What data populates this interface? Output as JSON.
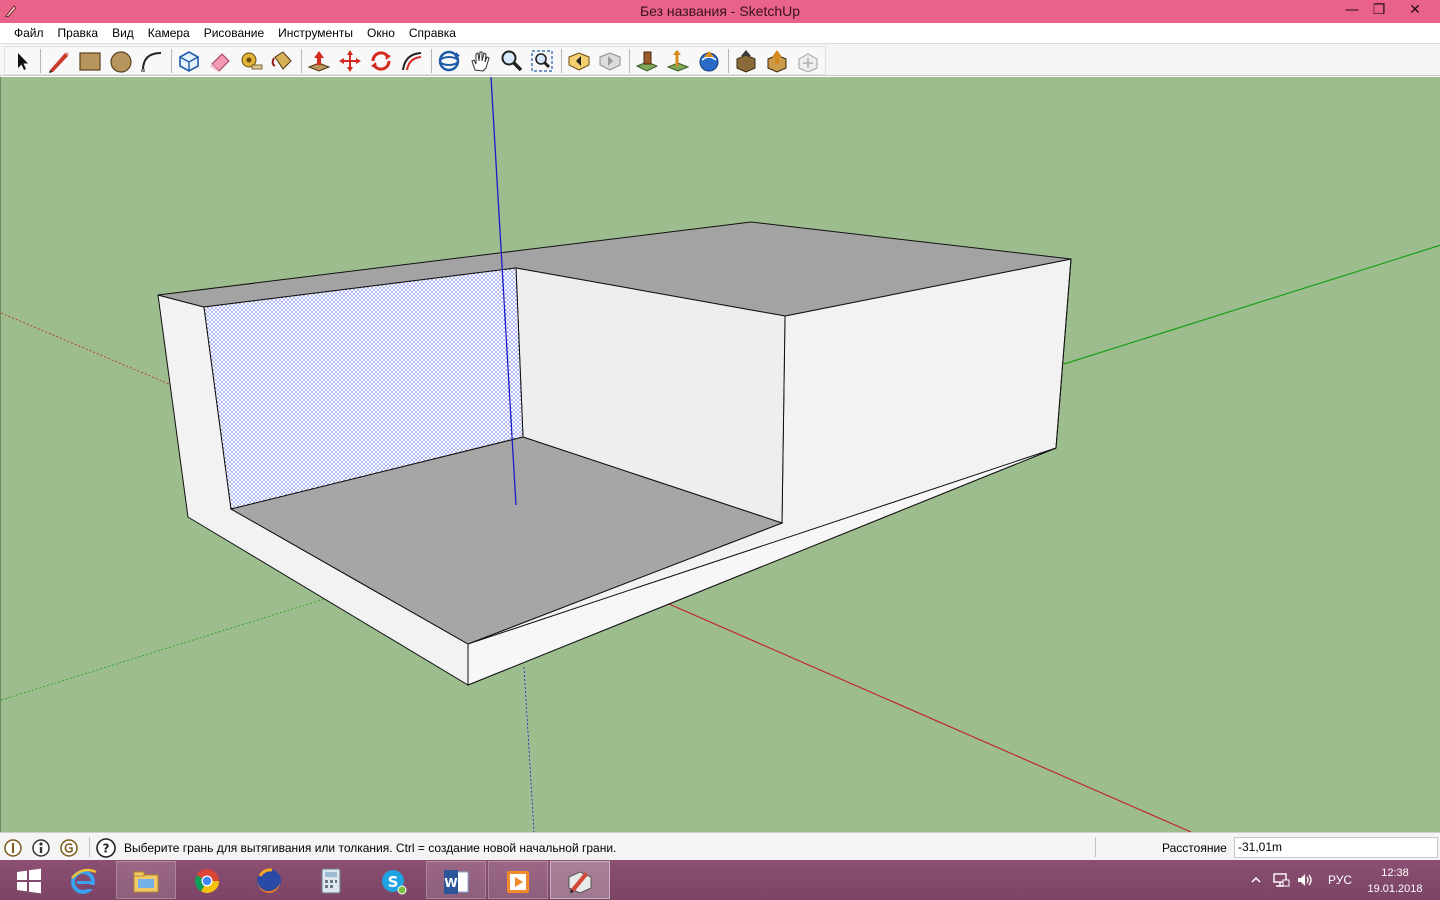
{
  "window": {
    "title": "Без названия - SketchUp",
    "min_glyph": "—",
    "max_glyph": "❐",
    "close_glyph": "✕"
  },
  "menu": [
    "Файл",
    "Правка",
    "Вид",
    "Камера",
    "Рисование",
    "Инструменты",
    "Окно",
    "Справка"
  ],
  "toolbar": {
    "tools": [
      "select-tool-icon",
      "pencil-line-tool-icon",
      "rectangle-tool-icon",
      "circle-tool-icon",
      "arc-tool-icon",
      "make-component-icon",
      "eraser-tool-icon",
      "tape-measure-tool-icon",
      "paint-bucket-tool-icon",
      "push-pull-tool-icon",
      "move-tool-icon",
      "rotate-tool-icon",
      "follow-me-tool-icon",
      "orbit-tool-icon",
      "pan-tool-icon",
      "zoom-tool-icon",
      "zoom-extents-icon",
      "previous-view-icon",
      "next-view-icon",
      "add-location-icon",
      "toggle-terrain-icon",
      "get-models-icon",
      "share-model-icon",
      "upload-component-icon",
      "extension-warehouse-icon"
    ]
  },
  "colors": {
    "titlebar": "#e8628a",
    "viewport_background": "#9dbd8e",
    "axis_red": "#c0272d",
    "axis_green": "#1aa11a",
    "axis_blue": "#1c1cc8",
    "selection_fill": "#aab2f0"
  },
  "status": {
    "icons": [
      "geo-location-icon",
      "credits-icon",
      "user-account-icon"
    ],
    "help_icon": "help-icon",
    "hint": "Выберите грань для вытягивания или толкания.  Ctrl = создание новой начальной грани.",
    "measurement_label": "Расстояние",
    "measurement_value": "-31,01m"
  },
  "taskbar": {
    "items": [
      "windows-start-icon",
      "internet-explorer-icon",
      "file-explorer-icon",
      "chrome-icon",
      "firefox-icon",
      "calculator-icon",
      "skype-icon",
      "word-icon",
      "media-player-icon",
      "sketchup-icon"
    ],
    "language": "РУС",
    "time": "12:38",
    "date": "19.01.2018"
  }
}
